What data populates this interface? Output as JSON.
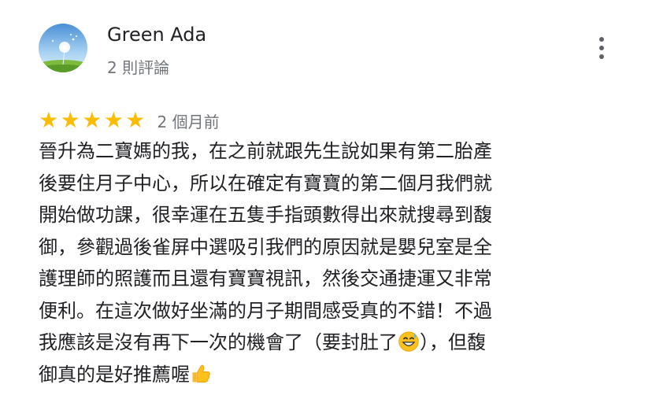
{
  "review": {
    "reviewer_name": "Green Ada",
    "review_count": "2 則評論",
    "rating": 5,
    "rating_stars": [
      "★",
      "★",
      "★",
      "★",
      "★"
    ],
    "date": "2 個月前",
    "text_lines": [
      "晉升為二寶媽的我，在之前就跟先生說如果有第二胎產",
      "後要住月子中心，所以在確定有寶寶的第二個月我們就",
      "開始做功課，很幸運在五隻手指頭數得出來就搜尋到馥",
      "御，參觀過後雀屏中選吸引我們的原因就是嬰兒室是全",
      "護理師的照護而且還有寶寶視訊，然後交通捷運又非常",
      "便利。在這次做好坐滿的月子期間感受真的不錯！不過",
      "我應該是沒有再下一次的機會了（要封肚了",
      "），但馥",
      "御真的是好推薦喔"
    ],
    "emojis": [
      "grinning-sweat-emoji",
      "thumbs-up-emoji"
    ]
  },
  "colors": {
    "star": "#fbbc04",
    "name": "#202124",
    "secondary": "#70757a",
    "menu_dots": "#5f6368"
  },
  "icons": {
    "more": "more-vert-icon"
  }
}
